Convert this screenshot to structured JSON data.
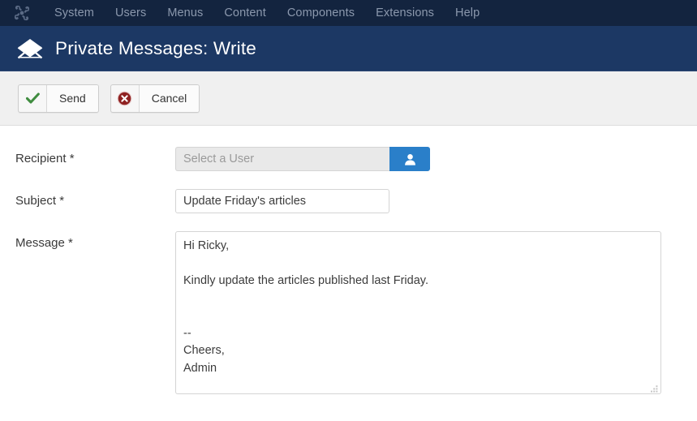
{
  "topbar": {
    "logo_icon": "joomla-logo-icon",
    "menu": [
      {
        "label": "System"
      },
      {
        "label": "Users"
      },
      {
        "label": "Menus"
      },
      {
        "label": "Content"
      },
      {
        "label": "Components"
      },
      {
        "label": "Extensions"
      },
      {
        "label": "Help"
      }
    ]
  },
  "header": {
    "icon": "envelope-icon",
    "title": "Private Messages: Write"
  },
  "toolbar": {
    "send": {
      "label": "Send",
      "icon": "check-icon",
      "icon_color": "#3f8c3f"
    },
    "cancel": {
      "label": "Cancel",
      "icon": "cancel-circle-icon",
      "icon_color": "#8f2121"
    }
  },
  "form": {
    "recipient": {
      "label": "Recipient *",
      "value": "",
      "placeholder": "Select a User",
      "picker_icon": "user-icon",
      "picker_color": "#2a7fc9"
    },
    "subject": {
      "label": "Subject *",
      "value": "Update Friday's articles",
      "placeholder": ""
    },
    "message": {
      "label": "Message *",
      "value": "Hi Ricky,\n\nKindly update the articles published last Friday.\n\n\n--\nCheers,\nAdmin",
      "placeholder": ""
    }
  },
  "colors": {
    "topbar_bg": "#13243f",
    "titlebar_bg": "#1c3864",
    "toolbar_bg": "#f0f0f0",
    "accent_blue": "#2a7fc9"
  }
}
